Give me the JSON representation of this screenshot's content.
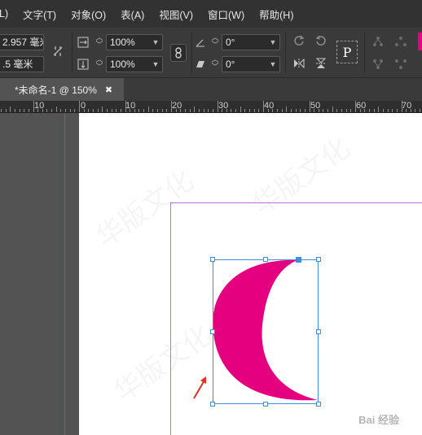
{
  "menubar": {
    "items": [
      "L)",
      "文字(T)",
      "对象(O)",
      "表(A)",
      "视图(V)",
      "窗口(W)",
      "帮助(H)"
    ]
  },
  "controls": {
    "width_value": "2.957 毫米",
    "height_value": ".5 毫米",
    "scale_x": "100%",
    "scale_y": "100%",
    "rotate_angle": "0°",
    "shear_angle": "0°",
    "type_glyph": "P"
  },
  "document_tab": {
    "title": "*未命名-1 @ 150%",
    "close_glyph": "✖"
  },
  "ruler": {
    "labels": [
      "10",
      "0",
      "10",
      "20",
      "30",
      "40",
      "50",
      "60",
      "70"
    ]
  },
  "shape": {
    "type": "crescent",
    "fill": "#e4007f",
    "frame_color": "#3d8ee0"
  },
  "annotation": {
    "arrow_color": "#e03020"
  },
  "watermark": {
    "text": "Bai 经验",
    "faint_text": "华版文化"
  },
  "colors": {
    "accent_magenta": "#e4007f",
    "selection_blue": "#3d8ee0",
    "margin_guide": "#c070d8",
    "bleed_guide": "#c0405a"
  }
}
